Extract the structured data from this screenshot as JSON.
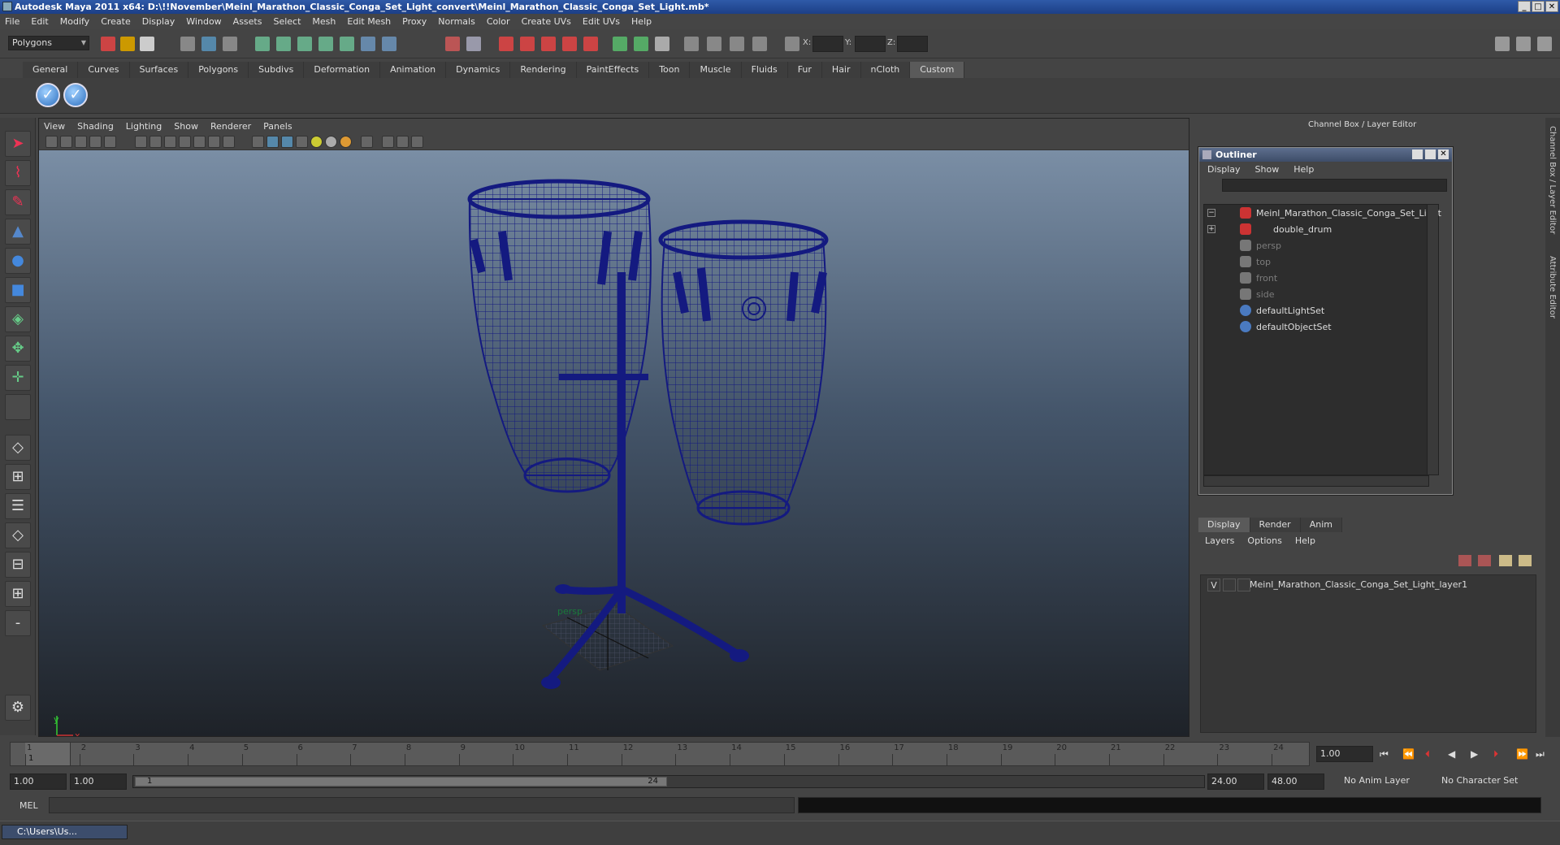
{
  "window": {
    "title": "Autodesk Maya 2011 x64: D:\\!!November\\Meinl_Marathon_Classic_Conga_Set_Light_convert\\Meinl_Marathon_Classic_Conga_Set_Light.mb*",
    "controls": [
      "_",
      "□",
      "✕"
    ]
  },
  "menubar": [
    "File",
    "Edit",
    "Modify",
    "Create",
    "Display",
    "Window",
    "Assets",
    "Select",
    "Mesh",
    "Edit Mesh",
    "Proxy",
    "Normals",
    "Color",
    "Create UVs",
    "Edit UVs",
    "Help"
  ],
  "statusline": {
    "mode": "Polygons",
    "x_label": "X:",
    "y_label": "Y:",
    "z_label": "Z:"
  },
  "shelf": {
    "tabs": [
      "General",
      "Curves",
      "Surfaces",
      "Polygons",
      "Subdivs",
      "Deformation",
      "Animation",
      "Dynamics",
      "Rendering",
      "PaintEffects",
      "Toon",
      "Muscle",
      "Fluids",
      "Fur",
      "Hair",
      "nCloth",
      "Custom"
    ],
    "active_tab": "Custom"
  },
  "viewport": {
    "menu": [
      "View",
      "Shading",
      "Lighting",
      "Show",
      "Renderer",
      "Panels"
    ],
    "camera": "persp",
    "axis_y": "y",
    "axis_x": "x",
    "wire_color": "#141a80"
  },
  "channel_box": {
    "title": "Channel Box / Layer Editor"
  },
  "outliner": {
    "title": "Outliner",
    "menu": [
      "Display",
      "Show",
      "Help"
    ],
    "items": [
      {
        "label": "Meinl_Marathon_Classic_Conga_Set_Light",
        "dim": false
      },
      {
        "label": "double_drum",
        "dim": false
      },
      {
        "label": "persp",
        "dim": true
      },
      {
        "label": "top",
        "dim": true
      },
      {
        "label": "front",
        "dim": true
      },
      {
        "label": "side",
        "dim": true
      },
      {
        "label": "defaultLightSet",
        "dim": false
      },
      {
        "label": "defaultObjectSet",
        "dim": false
      }
    ]
  },
  "layer_editor": {
    "tabs": [
      "Display",
      "Render",
      "Anim"
    ],
    "menu": [
      "Layers",
      "Options",
      "Help"
    ],
    "layer": {
      "visible": "V",
      "name": "Meinl_Marathon_Classic_Conga_Set_Light_layer1"
    }
  },
  "side_tabs": [
    "Channel Box / Layer Editor",
    "Attribute Editor"
  ],
  "timeline": {
    "frames": [
      "1",
      "2",
      "3",
      "4",
      "5",
      "6",
      "7",
      "8",
      "9",
      "10",
      "11",
      "12",
      "13",
      "14",
      "15",
      "16",
      "17",
      "18",
      "19",
      "20",
      "21",
      "22",
      "23",
      "24"
    ],
    "current_frame": "1",
    "current_field": "1.00"
  },
  "range": {
    "start": "1.00",
    "anim_start": "1.00",
    "slider_start": "1",
    "slider_end": "24",
    "end": "24.00",
    "anim_end": "48.00",
    "anim_layer": "No Anim Layer",
    "character_set": "No Character Set"
  },
  "command": {
    "label": "MEL"
  },
  "taskbar": {
    "item": "C:\\Users\\Us..."
  }
}
